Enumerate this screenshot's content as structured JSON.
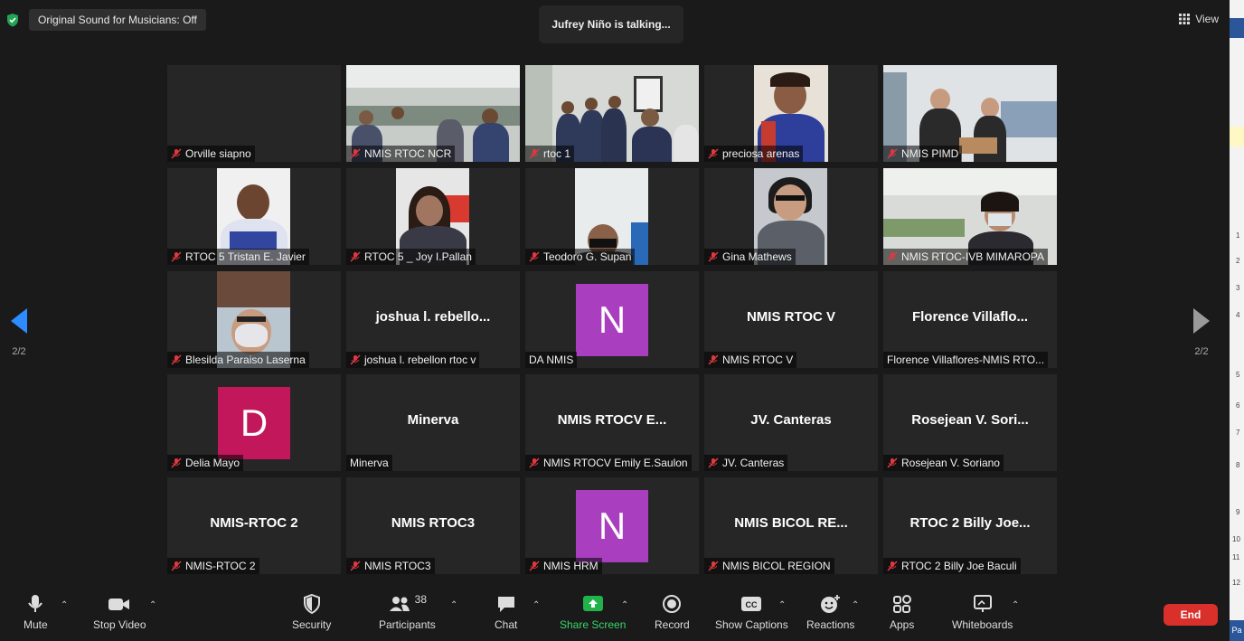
{
  "meeting": {
    "original_sound": "Original Sound for Musicians: Off",
    "talking": "Jufrey Niño is talking...",
    "view_label": "View",
    "page_indicator_left": "2/2",
    "page_indicator_right": "2/2"
  },
  "tiles": [
    {
      "label": "Orville siapno",
      "muted": true,
      "type": "blank"
    },
    {
      "label": "NMIS RTOC NCR",
      "muted": true,
      "type": "video"
    },
    {
      "label": "rtoc 1",
      "muted": true,
      "type": "video"
    },
    {
      "label": "preciosa arenas",
      "muted": true,
      "type": "video"
    },
    {
      "label": "NMIS PIMD",
      "muted": true,
      "type": "video"
    },
    {
      "label": "RTOC 5 Tristan E. Javier",
      "muted": true,
      "type": "video"
    },
    {
      "label": "RTOC 5 _ Joy I.Pallan",
      "muted": true,
      "type": "video"
    },
    {
      "label": "Teodoro G. Supan",
      "muted": true,
      "type": "video"
    },
    {
      "label": "Gina Mathews",
      "muted": true,
      "type": "video"
    },
    {
      "label": "NMIS RTOC-IVB MIMAROPA",
      "muted": true,
      "type": "video"
    },
    {
      "label": "Blesilda Paraiso Laserna",
      "muted": true,
      "type": "video"
    },
    {
      "label": "joshua l. rebellon rtoc v",
      "muted": true,
      "type": "name",
      "bigname": "joshua  l.  rebello..."
    },
    {
      "label": "DA NMIS",
      "muted": false,
      "type": "avatar",
      "letter": "N",
      "color": "#a93fbf"
    },
    {
      "label": "NMIS RTOC V",
      "muted": true,
      "type": "name",
      "bigname": "NMIS RTOC V"
    },
    {
      "label": "Florence Villaflores-NMIS RTO...",
      "muted": false,
      "type": "name",
      "bigname": "Florence  Villaflo..."
    },
    {
      "label": "Delia Mayo",
      "muted": true,
      "type": "avatar",
      "letter": "D",
      "color": "#c2185b"
    },
    {
      "label": "Minerva",
      "muted": false,
      "type": "name",
      "bigname": "Minerva"
    },
    {
      "label": "NMIS RTOCV Emily E.Saulon",
      "muted": true,
      "type": "name",
      "bigname": "NMIS  RTOCV  E..."
    },
    {
      "label": "JV. Canteras",
      "muted": true,
      "type": "name",
      "bigname": "JV. Canteras"
    },
    {
      "label": "Rosejean V. Soriano",
      "muted": true,
      "type": "name",
      "bigname": "Rosejean  V.  Sori..."
    },
    {
      "label": "NMIS-RTOC 2",
      "muted": true,
      "type": "name",
      "bigname": "NMIS-RTOC 2"
    },
    {
      "label": "NMIS RTOC3",
      "muted": true,
      "type": "name",
      "bigname": "NMIS RTOC3"
    },
    {
      "label": "NMIS HRM",
      "muted": true,
      "type": "avatar",
      "letter": "N",
      "color": "#a93fbf"
    },
    {
      "label": "NMIS BICOL REGION",
      "muted": true,
      "type": "name",
      "bigname": "NMIS  BICOL  RE..."
    },
    {
      "label": "RTOC 2 Billy Joe Baculi",
      "muted": true,
      "type": "name",
      "bigname": "RTOC  2  Billy  Joe..."
    }
  ],
  "toolbar": {
    "mute": "Mute",
    "stop_video": "Stop Video",
    "security": "Security",
    "participants": "Participants",
    "participants_count": "38",
    "chat": "Chat",
    "share_screen": "Share Screen",
    "record": "Record",
    "show_captions": "Show Captions",
    "reactions": "Reactions",
    "apps": "Apps",
    "whiteboards": "Whiteboards",
    "end": "End"
  },
  "side_panel": {
    "ruler_numbers": [
      "1",
      "2",
      "3",
      "4",
      "5",
      "6",
      "7",
      "8",
      "9",
      "10",
      "11",
      "12"
    ],
    "bottom_text": "Pa"
  },
  "colors": {
    "background": "#1a1a1a",
    "tile": "#262626",
    "share_green": "#21b24b",
    "end_red": "#d9302c",
    "nav_arrow": "#2d8cff",
    "mute_red": "#e0383e"
  }
}
